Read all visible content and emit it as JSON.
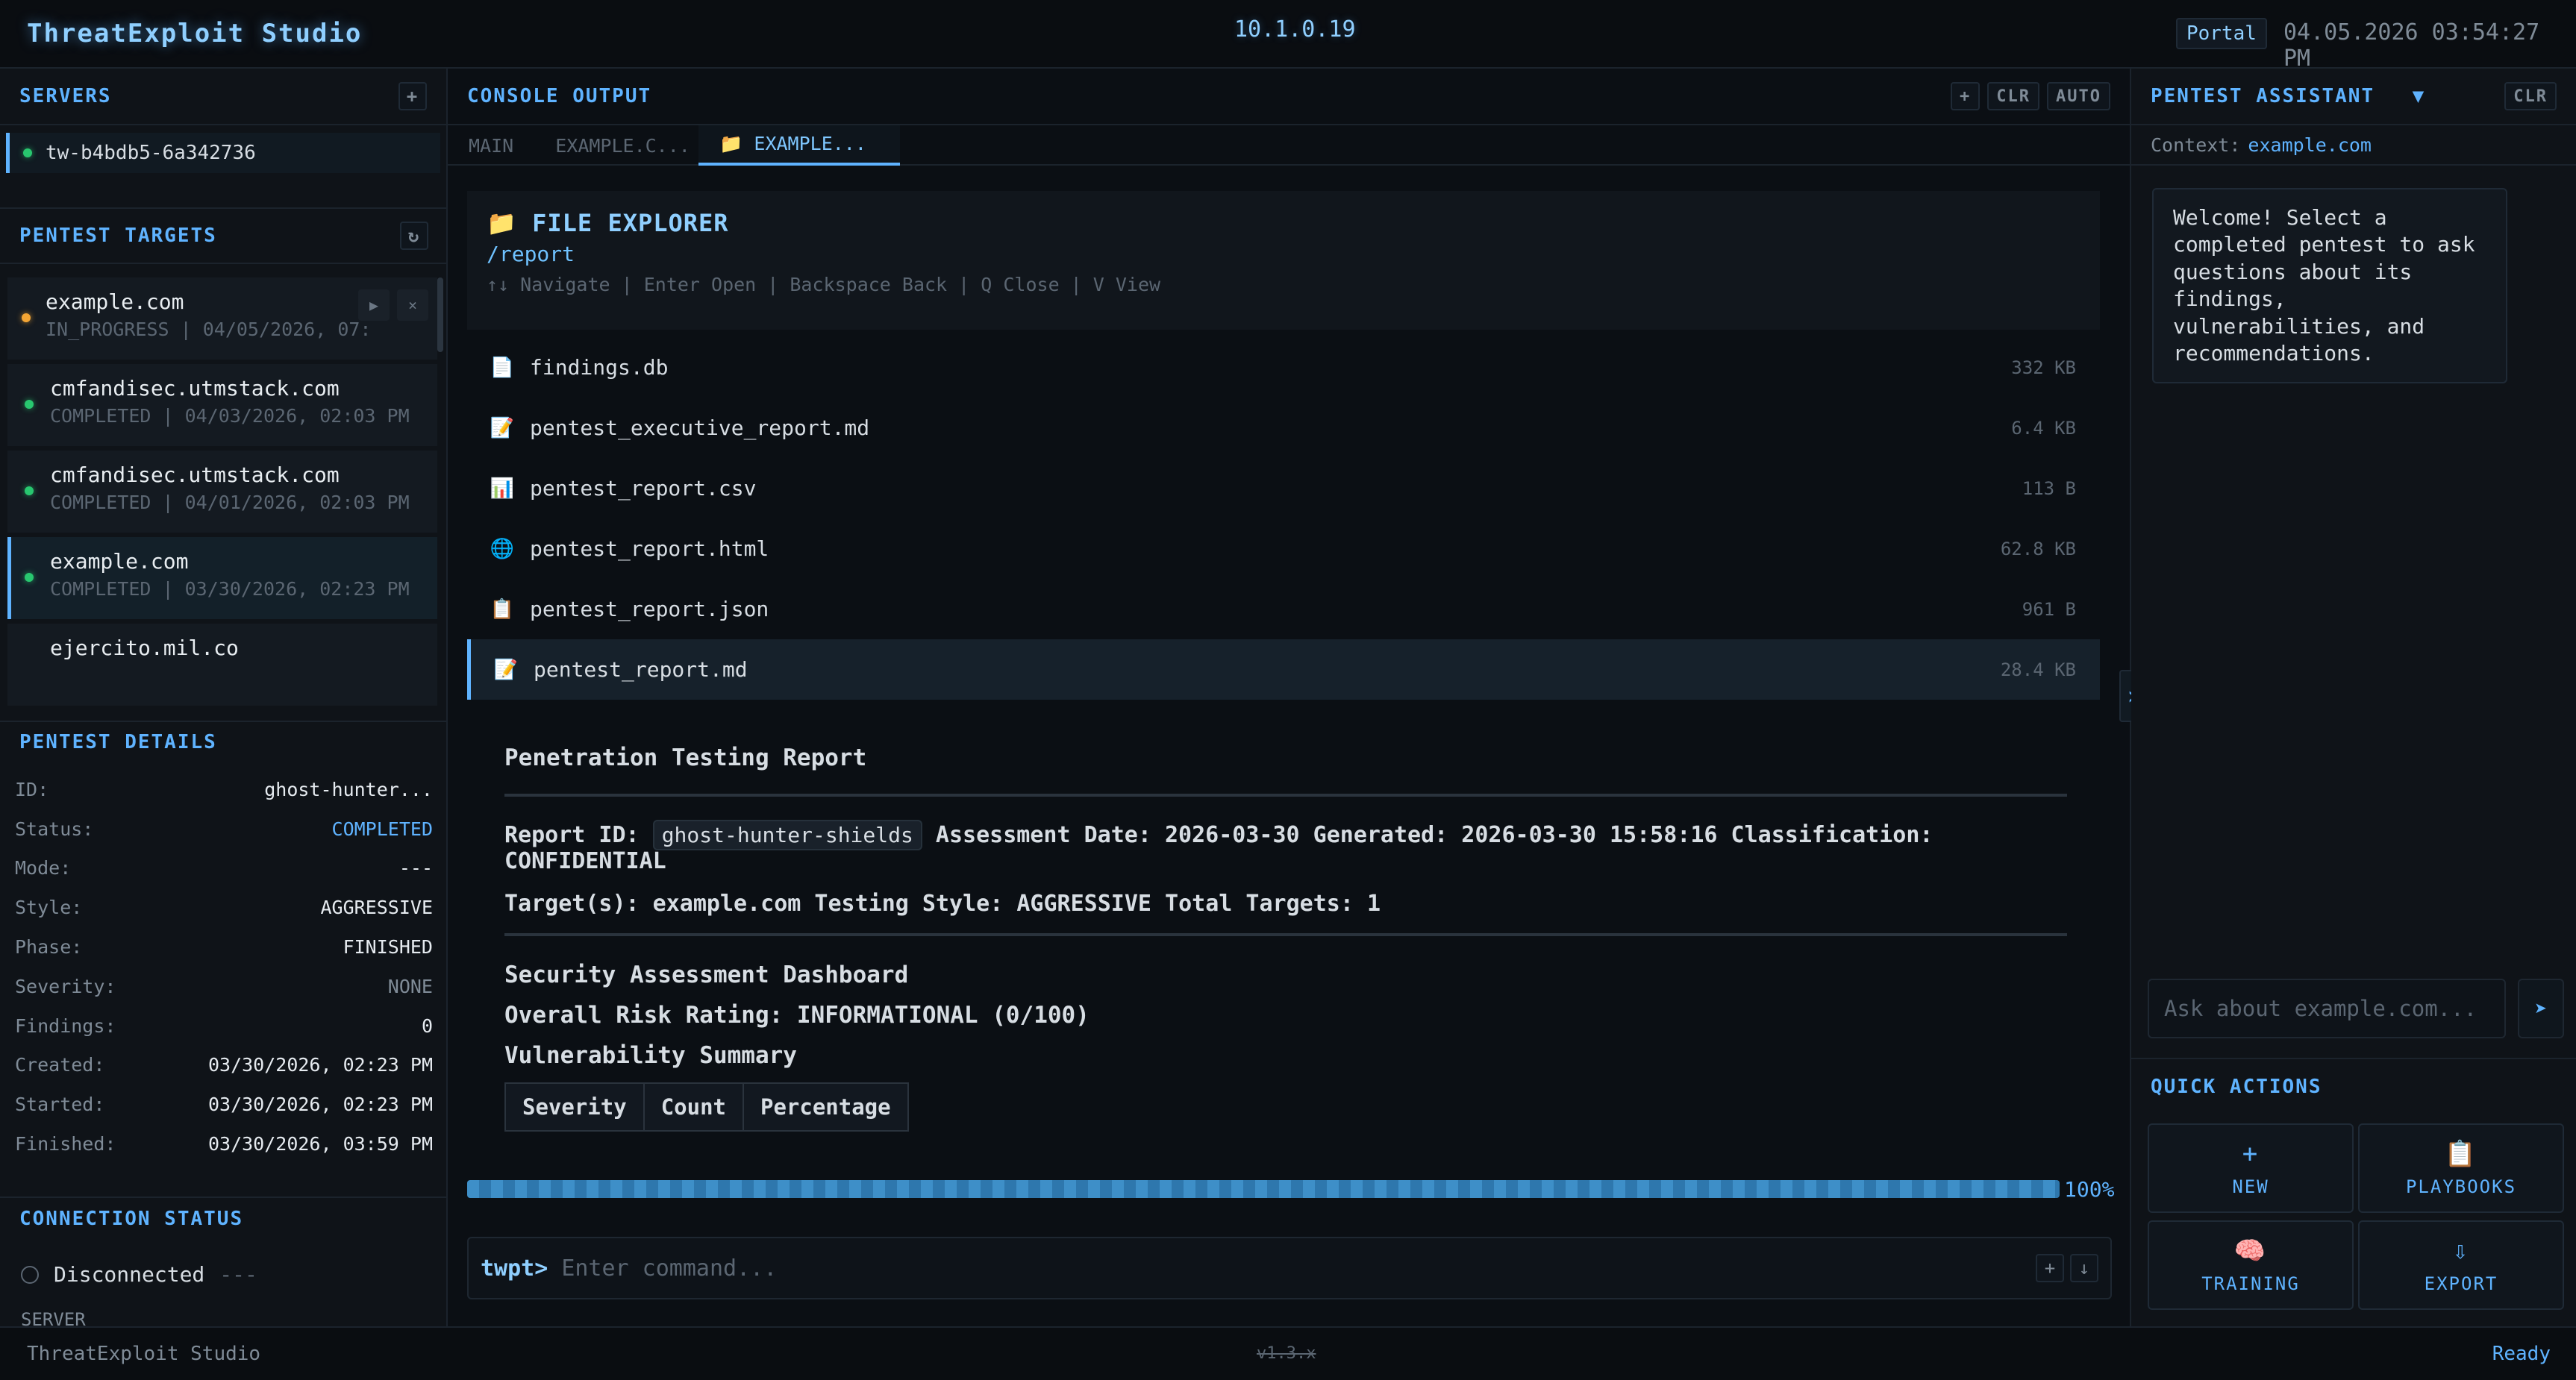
{
  "topbar": {
    "brand": "ThreatExploit Studio",
    "ip": "10.1.0.19",
    "portal": "Portal",
    "datetime": "04.05.2026 03:54:27 PM"
  },
  "servers": {
    "title": "SERVERS",
    "items": [
      {
        "label": "tw-b4bdb5-6a342736"
      }
    ]
  },
  "targets": {
    "title": "PENTEST TARGETS",
    "items": [
      {
        "name": "example.com",
        "meta": "IN_PROGRESS | 04/05/2026, 07:..."
      },
      {
        "name": "cmfandisec.utmstack.com",
        "meta": "COMPLETED | 04/03/2026, 02:03 PM"
      },
      {
        "name": "cmfandisec.utmstack.com",
        "meta": "COMPLETED | 04/01/2026, 02:03 PM"
      },
      {
        "name": "example.com",
        "meta": "COMPLETED | 03/30/2026, 02:23 PM"
      },
      {
        "name": "ejercito.mil.co",
        "meta": ""
      }
    ]
  },
  "details": {
    "title": "PENTEST DETAILS",
    "rows": [
      {
        "k": "ID:",
        "v": "ghost-hunter..."
      },
      {
        "k": "Status:",
        "v": "COMPLETED"
      },
      {
        "k": "Mode:",
        "v": "---"
      },
      {
        "k": "Style:",
        "v": "AGGRESSIVE"
      },
      {
        "k": "Phase:",
        "v": "FINISHED"
      },
      {
        "k": "Severity:",
        "v": "NONE"
      },
      {
        "k": "Findings:",
        "v": "0"
      },
      {
        "k": "Created:",
        "v": "03/30/2026, 02:23 PM"
      },
      {
        "k": "Started:",
        "v": "03/30/2026, 02:23 PM"
      },
      {
        "k": "Finished:",
        "v": "03/30/2026, 03:59 PM"
      }
    ]
  },
  "connection": {
    "title": "CONNECTION STATUS",
    "status": "Disconnected",
    "status_extra": "---",
    "server_label": "SERVER",
    "server_value": "---"
  },
  "console": {
    "title": "CONSOLE OUTPUT",
    "buttons": {
      "add": "+",
      "clr": "CLR",
      "auto": "AUTO"
    },
    "tabs": [
      {
        "label": "MAIN"
      },
      {
        "label": "EXAMPLE.C..."
      },
      {
        "label": "📁 EXAMPLE..."
      }
    ]
  },
  "explorer": {
    "title": "📁 FILE EXPLORER",
    "path": "/report",
    "hint": "↑↓ Navigate | Enter Open | Backspace Back | Q Close | V View",
    "files": [
      {
        "icon": "📄",
        "name": "findings.db",
        "size": "332 KB"
      },
      {
        "icon": "📝",
        "name": "pentest_executive_report.md",
        "size": "6.4 KB"
      },
      {
        "icon": "📊",
        "name": "pentest_report.csv",
        "size": "113 B"
      },
      {
        "icon": "🌐",
        "name": "pentest_report.html",
        "size": "62.8 KB"
      },
      {
        "icon": "📋",
        "name": "pentest_report.json",
        "size": "961 B"
      },
      {
        "icon": "📝",
        "name": "pentest_report.md",
        "size": "28.4 KB"
      }
    ]
  },
  "report": {
    "title": "Penetration Testing Report",
    "report_id_label": "Report ID:",
    "report_id": "ghost-hunter-shields",
    "line1_rest": "Assessment Date: 2026-03-30 Generated: 2026-03-30 15:58:16 Classification: CONFIDENTIAL",
    "line2": "Target(s): example.com Testing Style: AGGRESSIVE Total Targets: 1",
    "dashboard_title": "Security Assessment Dashboard",
    "risk": "Overall Risk Rating: INFORMATIONAL (0/100)",
    "summary_title": "Vulnerability Summary",
    "table_headers": [
      "Severity",
      "Count",
      "Percentage"
    ]
  },
  "progress": {
    "value": 1.0,
    "label": "100%"
  },
  "command": {
    "prompt": "twpt>",
    "placeholder": "Enter command..."
  },
  "assistant": {
    "title": "PENTEST ASSISTANT",
    "clr": "CLR",
    "context_label": "Context:",
    "context_value": "example.com",
    "welcome": "Welcome! Select a completed pentest to ask questions about its findings, vulnerabilities, and recommendations.",
    "ask_placeholder": "Ask about example.com..."
  },
  "quick_actions": {
    "title": "QUICK ACTIONS",
    "items": [
      {
        "icon": "+",
        "label": "NEW"
      },
      {
        "icon": "📋",
        "label": "PLAYBOOKS"
      },
      {
        "icon": "🧠",
        "label": "TRAINING"
      },
      {
        "icon": "⇩",
        "label": "EXPORT"
      }
    ]
  },
  "statusbar": {
    "app": "ThreatExploit Studio",
    "version": "v1.3.x",
    "state": "Ready"
  }
}
